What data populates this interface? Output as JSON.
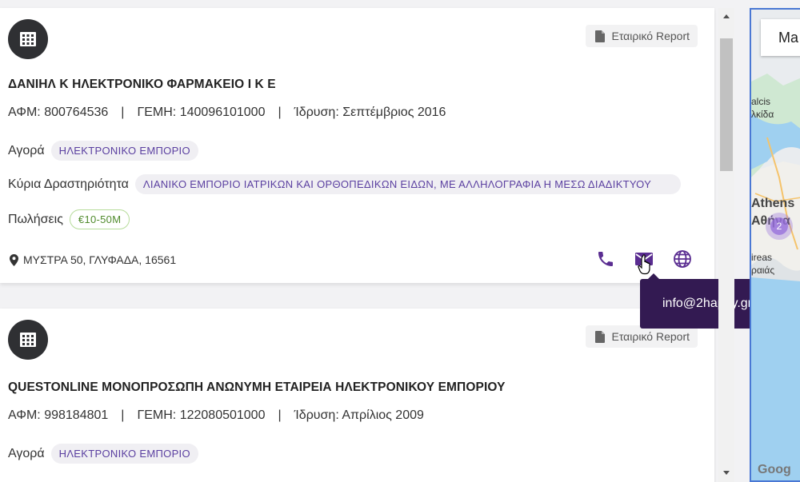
{
  "cards": [
    {
      "report_label": "Εταιρικό Report",
      "title": "ΔΑΝΙΗΛ Κ ΗΛΕΚΤΡΟΝΙΚΟ ΦΑΡΜΑΚΕΙΟ Ι Κ Ε",
      "afm": "ΑΦΜ: 800764536",
      "gemh": "ΓΕΜΗ: 140096101000",
      "founded": "Ίδρυση: Σεπτέμβριος 2016",
      "market_label": "Αγορά",
      "market_value": "ΗΛΕΚΤΡΟΝΙΚΟ ΕΜΠΟΡΙΟ",
      "activity_label": "Κύρια Δραστηριότητα",
      "activity_value": "ΛΙΑΝΙΚΟ ΕΜΠΟΡΙΟ ΙΑΤΡΙΚΩΝ ΚΑΙ ΟΡΘΟΠΕΔΙΚΩΝ ΕΙΔΩΝ, ΜΕ ΑΛΛΗΛΟΓΡΑΦΙΑ Η ΜΕΣΩ ΔΙΑΔΙΚΤΥΟΥ",
      "sales_label": "Πωλήσεις",
      "sales_value": "€10-50M",
      "address": "ΜΥΣΤΡΑ 50, ΓΛΥΦΑΔΑ, 16561"
    },
    {
      "report_label": "Εταιρικό Report",
      "title": "QUESTONLINE ΜΟΝΟΠΡΟΣΩΠΗ ΑΝΩΝΥΜΗ ΕΤΑΙΡΕΙΑ ΗΛΕΚΤΡΟΝΙΚΟΥ ΕΜΠΟΡΙΟΥ",
      "afm": "ΑΦΜ: 998184801",
      "gemh": "ΓΕΜΗ: 122080501000",
      "founded": "Ίδρυση: Απρίλιος 2009",
      "market_label": "Αγορά",
      "market_value": "ΗΛΕΚΤΡΟΝΙΚΟ ΕΜΠΟΡΙΟ"
    }
  ],
  "separator": "|",
  "tooltip": "info@2happy.gr",
  "map": {
    "button_label": "Ma",
    "labels": [
      "alcis",
      "λκίδα",
      "Athens",
      "Αθήνα",
      "ireas",
      "ραιάς"
    ],
    "cluster_count": "2",
    "attribution": "Goog"
  },
  "colors": {
    "accent": "#5a2d91",
    "tooltip_bg": "#331a52",
    "chip_text": "#5a3fa0",
    "sales_border": "#b6dc9a"
  }
}
